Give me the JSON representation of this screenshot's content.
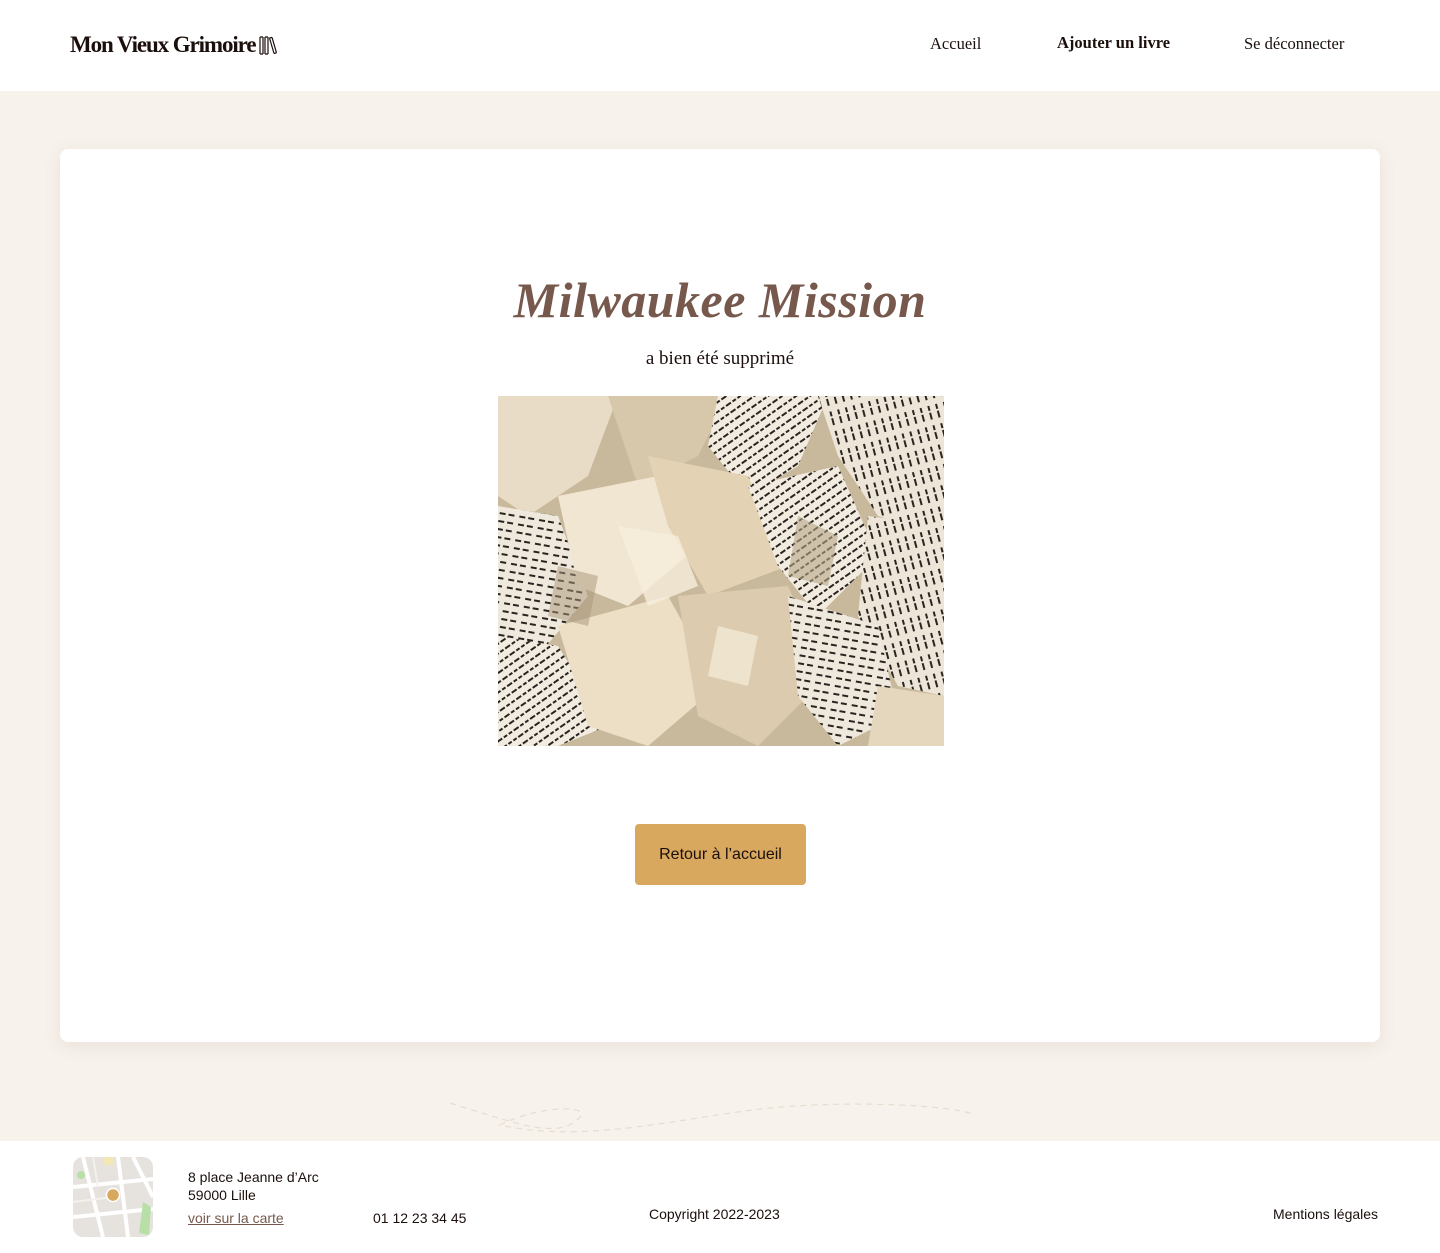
{
  "header": {
    "logo_text": "Mon Vieux Grimoire",
    "nav": {
      "home": "Accueil",
      "add_book": "Ajouter un livre",
      "logout": "Se déconnecter"
    }
  },
  "main": {
    "book_title": "Milwaukee Mission",
    "message": "a bien été supprimé",
    "image_icon": "crumpled-paper-image",
    "button_label": "Retour à l’accueil"
  },
  "footer": {
    "address_line1": "8 place Jeanne d’Arc",
    "address_line2": "59000 Lille",
    "map_link": "voir sur la carte",
    "phone": "01 12 23 34 45",
    "copyright": "Copyright 2022-2023",
    "legal": "Mentions légales"
  },
  "colors": {
    "accent": "#d9a85f",
    "title": "#77584c",
    "text": "#1b0f0c",
    "background": "#f7f2ec"
  }
}
